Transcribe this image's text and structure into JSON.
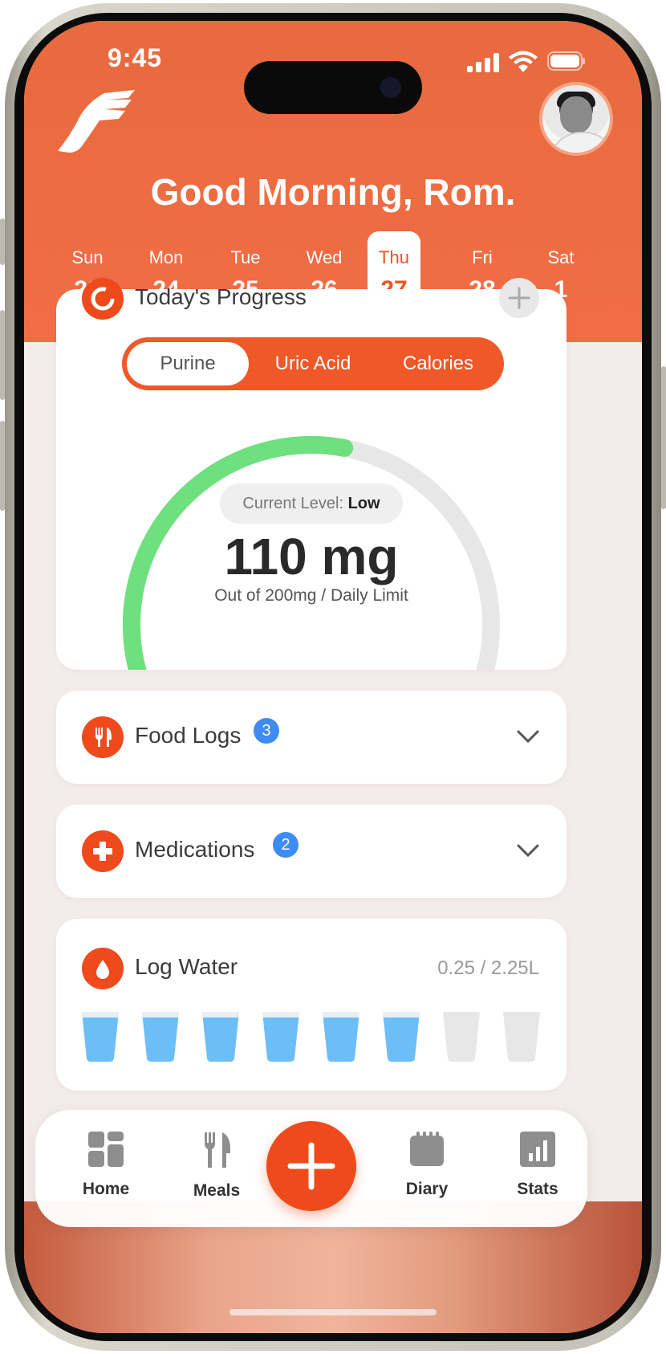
{
  "status_bar": {
    "time": "9:45"
  },
  "header": {
    "greeting": "Good Morning, Rom."
  },
  "week": [
    {
      "name": "Sun",
      "date": "23"
    },
    {
      "name": "Mon",
      "date": "24"
    },
    {
      "name": "Tue",
      "date": "25"
    },
    {
      "name": "Wed",
      "date": "26"
    },
    {
      "name": "Thu",
      "date": "27",
      "selected": true
    },
    {
      "name": "Fri",
      "date": "28"
    },
    {
      "name": "Sat",
      "date": "1"
    }
  ],
  "progress": {
    "title": "Today's Progress",
    "tabs": [
      "Purine",
      "Uric Acid",
      "Calories"
    ],
    "active_tab": "Purine",
    "level_label": "Current Level:",
    "level_value": "Low",
    "amount": "110 mg",
    "limit_text": "Out of 200mg / Daily Limit",
    "fill_fraction": 0.55
  },
  "food_logs": {
    "title": "Food Logs",
    "count": "3"
  },
  "medications": {
    "title": "Medications",
    "count": "2"
  },
  "water": {
    "title": "Log Water",
    "value": "0.25 / 2.25L",
    "filled_cups": 6,
    "total_cups": 8
  },
  "nav": {
    "items": [
      {
        "label": "Home",
        "icon": "home-grid-icon"
      },
      {
        "label": "Meals",
        "icon": "fork-knife-icon"
      },
      {
        "label": "Diary",
        "icon": "diary-icon"
      },
      {
        "label": "Stats",
        "icon": "stats-icon"
      }
    ]
  },
  "colors": {
    "accent": "#EE4A1C",
    "header": "#F06B43",
    "gauge_fill": "#6FE07E",
    "gauge_track": "#E7E7E7",
    "water": "#6DBDF7",
    "badge": "#3D8CF6"
  }
}
